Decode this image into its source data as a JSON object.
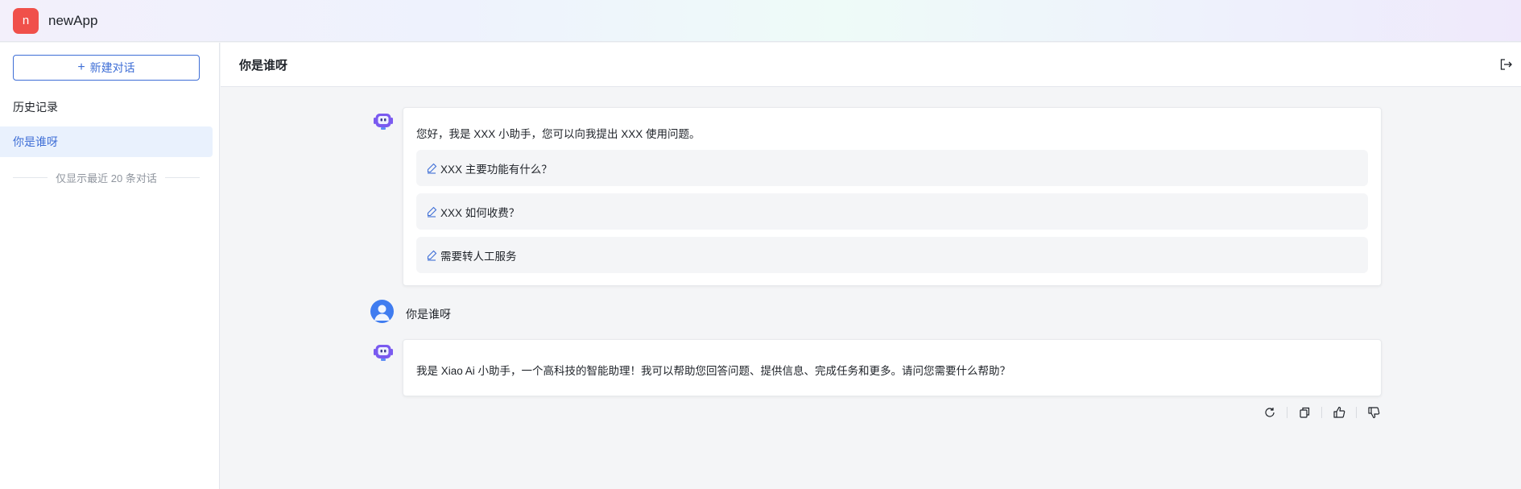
{
  "header": {
    "logo_letter": "n",
    "app_name": "newApp",
    "logo_color": "#f0504a"
  },
  "sidebar": {
    "new_chat_label": "新建对话",
    "history_title": "历史记录",
    "items": [
      {
        "label": "你是谁呀",
        "active": true
      }
    ],
    "note": "仅显示最近 20 条对话"
  },
  "main": {
    "title": "你是谁呀",
    "messages": {
      "greeting": "您好，我是 XXX 小助手，您可以向我提出 XXX 使用问题。",
      "suggestions": [
        "XXX 主要功能有什么？",
        "XXX 如何收费？",
        "需要转人工服务"
      ],
      "user_message": "你是谁呀",
      "answer": "我是 Xiao Ai 小助手，一个高科技的智能助理！我可以帮助您回答问题、提供信息、完成任务和更多。请问您需要什么帮助？"
    },
    "actions": [
      "refresh-icon",
      "copy-icon",
      "thumbs-up-icon",
      "thumbs-down-icon"
    ]
  },
  "colors": {
    "accent": "#3e6ed6",
    "active_bg": "#e9f1fd",
    "bot_avatar": "#7a5af0"
  }
}
